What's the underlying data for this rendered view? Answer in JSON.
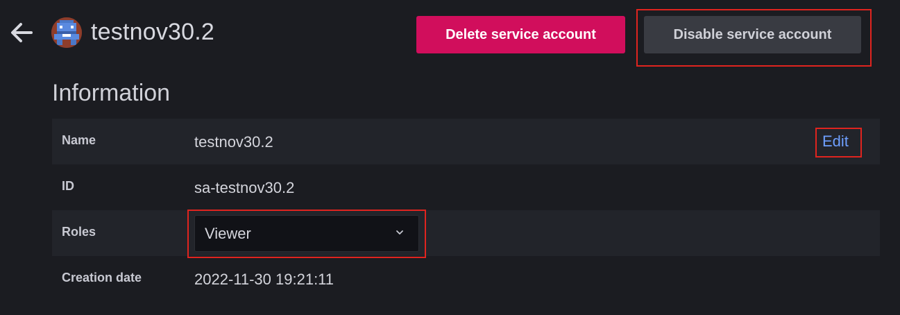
{
  "header": {
    "title": "testnov30.2",
    "back_icon": "arrow-left-icon",
    "avatar_icon": "robot-avatar-icon"
  },
  "actions": {
    "delete_label": "Delete service account",
    "disable_label": "Disable service account"
  },
  "section": {
    "title": "Information"
  },
  "info": {
    "name_label": "Name",
    "name_value": "testnov30.2",
    "edit_label": "Edit",
    "id_label": "ID",
    "id_value": "sa-testnov30.2",
    "roles_label": "Roles",
    "roles_value": "Viewer",
    "creation_label": "Creation date",
    "creation_value": "2022-11-30 19:21:11"
  },
  "colors": {
    "background": "#1b1c21",
    "delete_button": "#d10e5c",
    "disable_button": "#393b42",
    "link": "#6e9fff",
    "highlight": "#e0241f"
  }
}
